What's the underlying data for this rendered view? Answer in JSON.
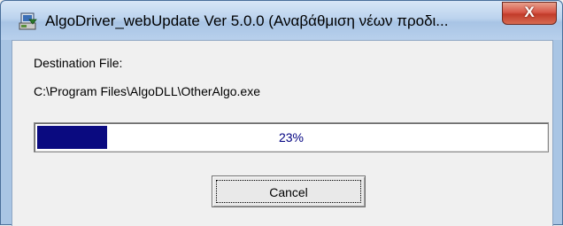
{
  "window": {
    "title": "AlgoDriver_webUpdate Ver 5.0.0 (Αναβάθμιση νέων προδι...",
    "close_label": "X",
    "icon": "app-install-icon"
  },
  "content": {
    "destination_label": "Destination File:",
    "destination_path": "C:\\Program Files\\AlgoDLL\\OtherAlgo.exe"
  },
  "progress": {
    "value": 23,
    "label": "23%",
    "fill_color": "#0a0a80"
  },
  "buttons": {
    "cancel_label": "Cancel"
  }
}
